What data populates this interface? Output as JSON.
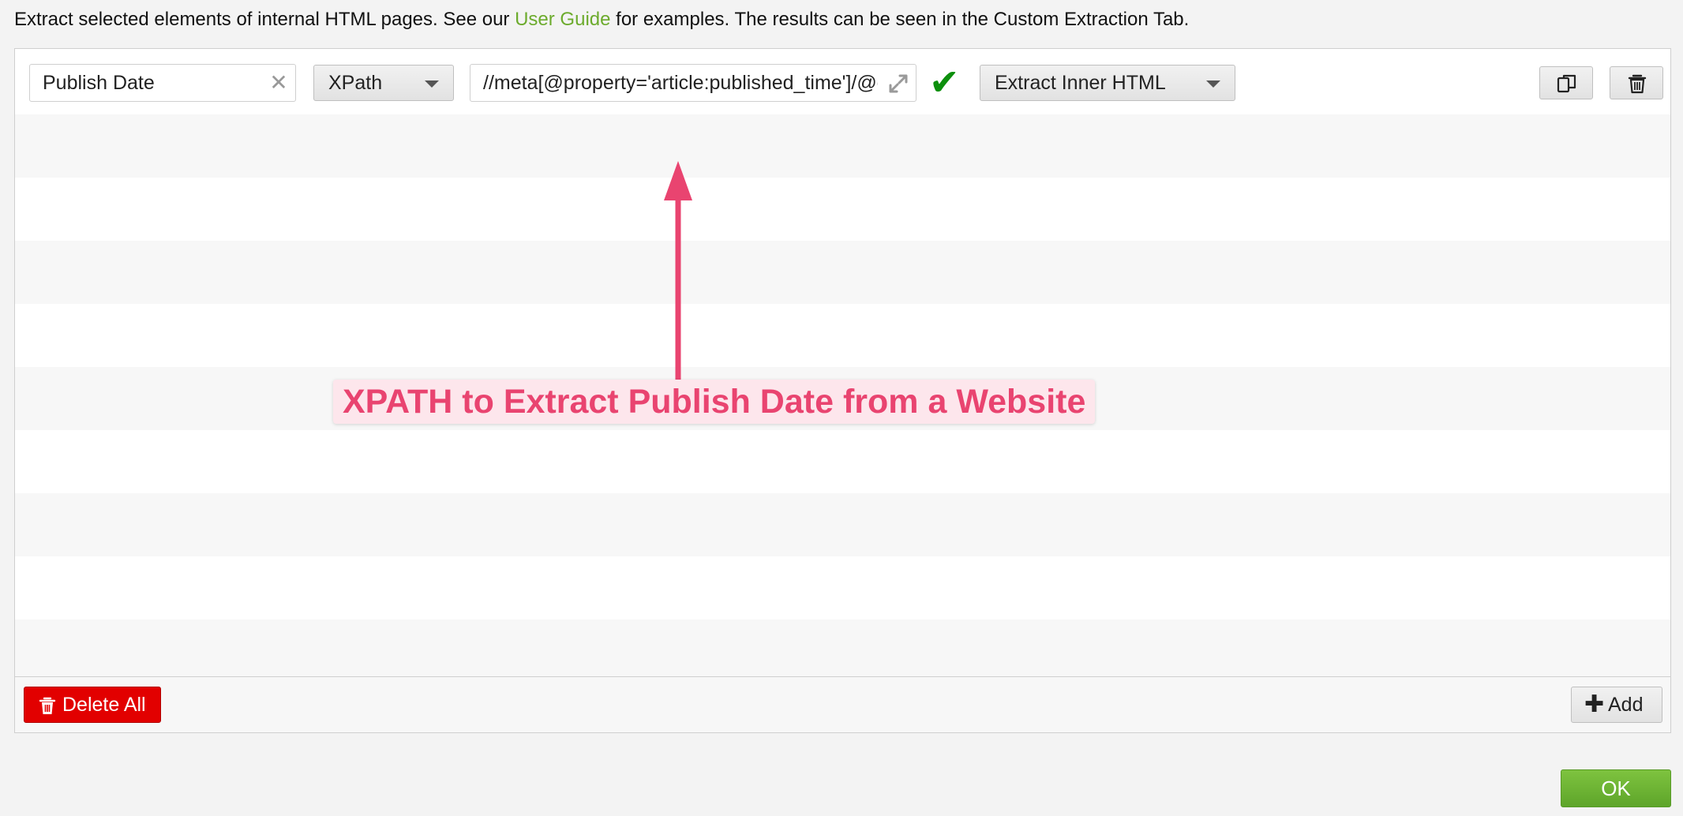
{
  "intro": {
    "text_before": "Extract selected elements of internal HTML pages. See our ",
    "link_text": "User Guide",
    "text_after": " for examples. The results can be seen in the Custom Extraction Tab."
  },
  "extractor": {
    "name_value": "Publish Date",
    "type_label": "XPath",
    "expression_value": "//meta[@property='article:published_time']/@content",
    "extract_mode_label": "Extract Inner HTML"
  },
  "annotation": {
    "text": "XPATH to Extract Publish Date from a Website"
  },
  "footer": {
    "delete_all_label": "Delete All",
    "add_label": "Add"
  },
  "dialog": {
    "ok_label": "OK"
  },
  "colors": {
    "link": "#6cab2d",
    "valid_check": "#0d8f0d",
    "annotation": "#e94470",
    "delete_button": "#e20000",
    "ok_button": "#6aae32"
  },
  "icons": {
    "clear": "clear-icon",
    "expand": "expand-icon",
    "valid": "checkmark-icon",
    "copy": "copy-icon",
    "delete": "trash-icon",
    "add": "plus-icon"
  }
}
